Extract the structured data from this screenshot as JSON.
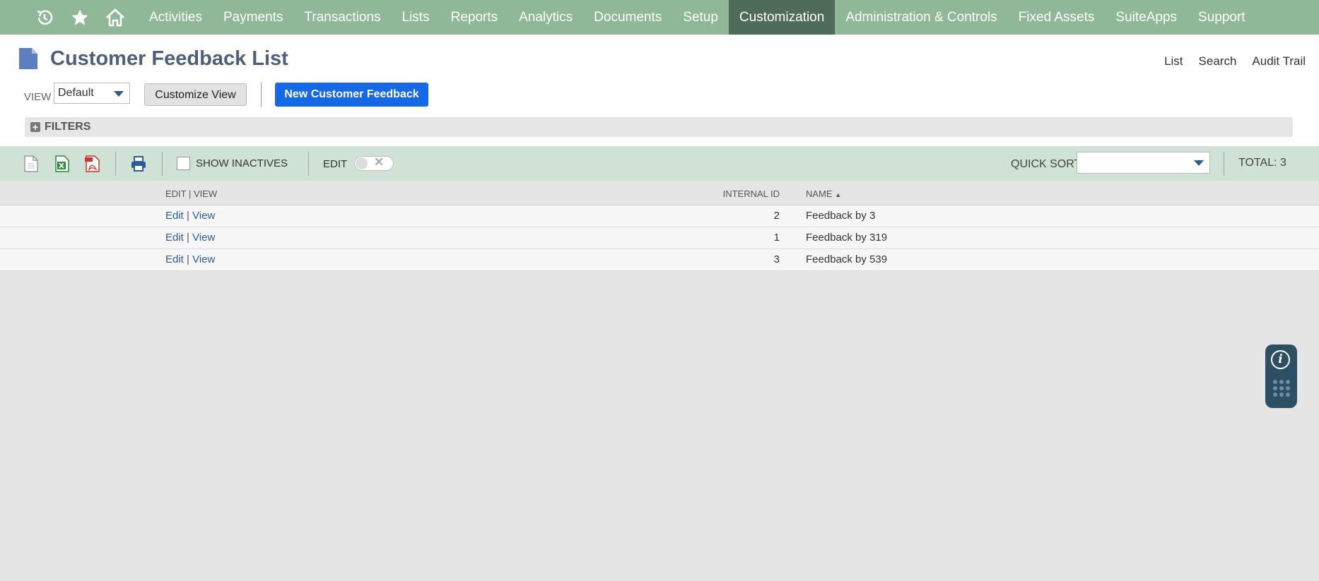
{
  "nav": {
    "icons": [
      "history-icon",
      "star-icon",
      "home-icon"
    ],
    "items": [
      {
        "label": "Activities"
      },
      {
        "label": "Payments"
      },
      {
        "label": "Transactions"
      },
      {
        "label": "Lists"
      },
      {
        "label": "Reports"
      },
      {
        "label": "Analytics"
      },
      {
        "label": "Documents"
      },
      {
        "label": "Setup"
      },
      {
        "label": "Customization",
        "active": true
      },
      {
        "label": "Administration & Controls"
      },
      {
        "label": "Fixed Assets"
      },
      {
        "label": "SuiteApps"
      },
      {
        "label": "Support"
      }
    ],
    "bg_color": "#8eb897",
    "active_color": "#4f6c58"
  },
  "header": {
    "title": "Customer Feedback List",
    "links": [
      "List",
      "Search",
      "Audit Trail"
    ],
    "view_label": "VIEW",
    "view_value": "Default",
    "customize_view": "Customize View",
    "new_button": "New Customer Feedback",
    "new_button_color": "#1568e6",
    "filters_label": "FILTERS"
  },
  "toolbar": {
    "show_inactives": "SHOW INACTIVES",
    "show_inactives_checked": false,
    "edit_label": "EDIT",
    "edit_toggle_on": false,
    "quick_sort_label": "QUICK SORT",
    "quick_sort_value": "",
    "total": "TOTAL: 3"
  },
  "table": {
    "headers": {
      "edit_view": "EDIT | VIEW",
      "internal_id": "INTERNAL ID",
      "name": "NAME"
    },
    "sort_indicator": "▲",
    "rows": [
      {
        "edit": "Edit",
        "sep": "|",
        "view": "View",
        "id": "2",
        "name": "Feedback by 3"
      },
      {
        "edit": "Edit",
        "sep": "|",
        "view": "View",
        "id": "1",
        "name": "Feedback by 319"
      },
      {
        "edit": "Edit",
        "sep": "|",
        "view": "View",
        "id": "3",
        "name": "Feedback by 539"
      }
    ]
  },
  "widget": {
    "info_glyph": "i"
  }
}
